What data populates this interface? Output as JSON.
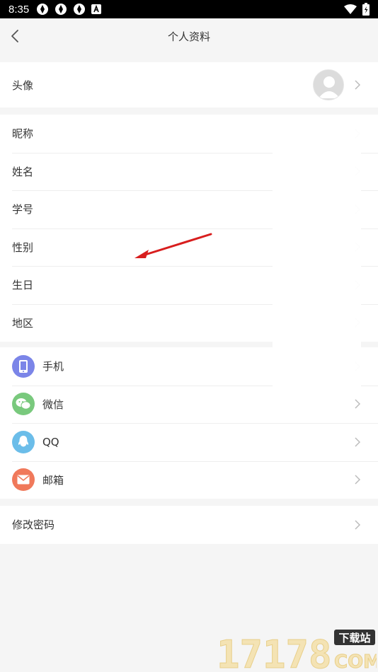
{
  "status": {
    "time": "8:35"
  },
  "header": {
    "title": "个人资料"
  },
  "profile": {
    "avatar_label": "头像"
  },
  "info_items": [
    {
      "label": "昵称"
    },
    {
      "label": "姓名"
    },
    {
      "label": "学号"
    },
    {
      "label": "性别"
    },
    {
      "label": "生日"
    },
    {
      "label": "地区"
    }
  ],
  "bindings": [
    {
      "label": "手机",
      "icon": "phone-icon",
      "color": "#7b85e8"
    },
    {
      "label": "微信",
      "icon": "wechat-icon",
      "color": "#79c97d"
    },
    {
      "label": "QQ",
      "icon": "qq-icon",
      "color": "#6bbde9"
    },
    {
      "label": "邮箱",
      "icon": "mail-icon",
      "color": "#f0795b"
    }
  ],
  "password": {
    "label": "修改密码"
  },
  "watermark": {
    "digits": "17178",
    "badge": "下载站",
    "com": "COM"
  }
}
